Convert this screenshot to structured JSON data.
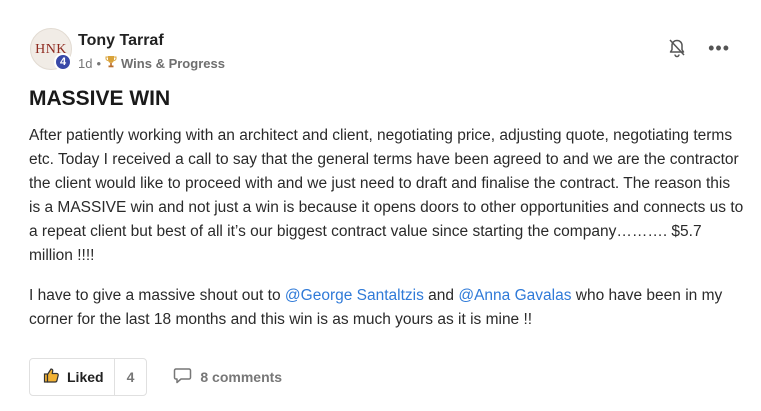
{
  "author": {
    "name": "Tony Tarraf",
    "avatar_text": "HNK",
    "level": "4"
  },
  "meta": {
    "time": "1d",
    "separator": "•",
    "category": "Wins & Progress"
  },
  "post": {
    "title": "MASSIVE WIN",
    "paragraph1": "After patiently working with an architect and client, negotiating price, adjusting quote, negotiating terms etc. Today I received a call to say that the general terms have been agreed to and we are the contractor the client would like to proceed with and we just need to draft and finalise the contract. The reason this is a MASSIVE win and not just a win is because it opens doors to other opportunities and connects us to a repeat client but best of all it’s our biggest contract value since starting the company………. $5.7 million !!!!",
    "p2_prefix": "I have to give a massive shout out to ",
    "mention1": "@George Santaltzis",
    "p2_and": " and ",
    "mention2": "@Anna Gavalas",
    "p2_suffix": " who have been in my corner for the last 18 months and this win is as much yours as it is mine !!"
  },
  "footer": {
    "liked_label": "Liked",
    "like_count": "4",
    "comments_label": "8 comments"
  },
  "icons": {
    "trophy": "trophy-icon",
    "bell": "bell-off-icon",
    "more": "more-options-icon",
    "like": "thumbs-up-icon",
    "comment": "comment-icon"
  },
  "colors": {
    "mention": "#2f7ad8",
    "badge": "#3949a8"
  }
}
